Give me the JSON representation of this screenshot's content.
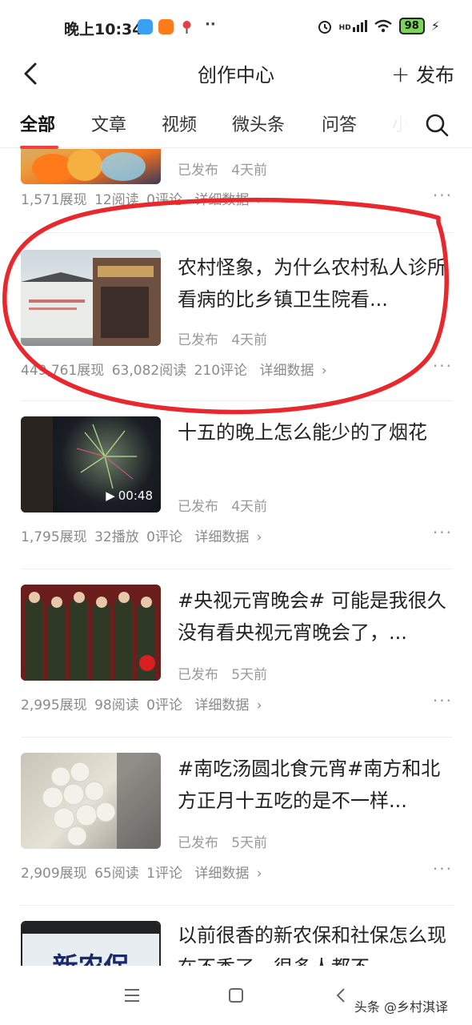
{
  "status_bar": {
    "time": "晚上10:34",
    "dots": "··",
    "signal": "HD",
    "battery": "98"
  },
  "header": {
    "title": "创作中心",
    "publish": "发布"
  },
  "tabs": [
    "全部",
    "文章",
    "视频",
    "微头条",
    "问答",
    "小"
  ],
  "items": [
    {
      "title": "",
      "publish_status": "已发布",
      "age": "4天前",
      "stats": [
        "1,571展现",
        "12阅读",
        "0评论"
      ],
      "detail": "详细数据",
      "thumb": "lantern-photo"
    },
    {
      "title": "农村怪象，为什么农村私人诊所看病的比乡镇卫生院看...",
      "publish_status": "已发布",
      "age": "4天前",
      "stats": [
        "449,761展现",
        "63,082阅读",
        "210评论"
      ],
      "detail": "详细数据",
      "thumb": "clinic-photo",
      "highlighted": true
    },
    {
      "title": "十五的晚上怎么能少的了烟花",
      "publish_status": "已发布",
      "age": "4天前",
      "stats": [
        "1,795展现",
        "32播放",
        "0评论"
      ],
      "detail": "详细数据",
      "thumb": "fireworks-video",
      "duration": "00:48"
    },
    {
      "title": "#央视元宵晚会# 可能是我很久没有看央视元宵晚会了，...",
      "publish_status": "已发布",
      "age": "5天前",
      "stats": [
        "2,995展现",
        "98阅读",
        "0评论"
      ],
      "detail": "详细数据",
      "thumb": "choir-photo"
    },
    {
      "title": "#南吃汤圆北食元宵#南方和北方正月十五吃的是不一样...",
      "publish_status": "已发布",
      "age": "5天前",
      "stats": [
        "2,909展现",
        "65阅读",
        "1评论"
      ],
      "detail": "详细数据",
      "thumb": "yuanxiao-photo"
    },
    {
      "title": "以前很香的新农保和社保怎么现在不香了，很多人都不...",
      "thumb": "insurance-photo",
      "thumb_text": "新农保"
    }
  ],
  "watermark": "头条 @乡村淇译",
  "colors": {
    "accent": "#f04142",
    "annotation": "#e8282c"
  }
}
